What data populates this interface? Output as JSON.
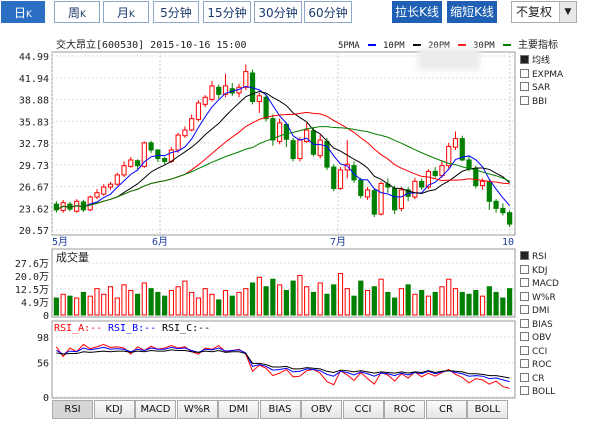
{
  "tabs": [
    {
      "label": "日",
      "k": "K"
    },
    {
      "label": "周",
      "k": "K"
    },
    {
      "label": "月",
      "k": "K"
    },
    {
      "label": "5分钟",
      "k": ""
    },
    {
      "label": "15分钟",
      "k": ""
    },
    {
      "label": "30分钟",
      "k": ""
    },
    {
      "label": "60分钟",
      "k": ""
    }
  ],
  "buttons": {
    "stretch": "拉长K线",
    "shrink": "缩短K线",
    "adjust": "不复权"
  },
  "main": {
    "title": "交大昂立[600530] 2015-10-16 15:00",
    "ma_legend": [
      {
        "label": "5PMA",
        "color": "#0000ff"
      },
      {
        "label": "10PM",
        "color": "#000000"
      },
      {
        "label": "20PM",
        "color": "#ff0000"
      },
      {
        "label": "30PM",
        "color": "#008000"
      }
    ],
    "main_indicator_label": "主要指标",
    "y_ticks": [
      "44.99",
      "41.94",
      "38.88",
      "35.83",
      "32.78",
      "29.73",
      "26.67",
      "23.62",
      "20.57"
    ],
    "x_ticks": [
      "5月",
      "6月",
      "7月",
      "10"
    ]
  },
  "right_indicators": [
    {
      "label": "均线",
      "checked": true
    },
    {
      "label": "EXPMA",
      "checked": false
    },
    {
      "label": "SAR",
      "checked": false
    },
    {
      "label": "BBI",
      "checked": false
    }
  ],
  "volume": {
    "title": "成交量",
    "y_ticks": [
      "27.6万",
      "20.0万",
      "12.5万",
      "4.9万",
      "0"
    ]
  },
  "volume_indicators": [
    {
      "label": "RSI",
      "checked": true
    },
    {
      "label": "KDJ",
      "checked": false
    },
    {
      "label": "MACD",
      "checked": false
    },
    {
      "label": "W%R",
      "checked": false
    },
    {
      "label": "DMI",
      "checked": false
    },
    {
      "label": "BIAS",
      "checked": false
    },
    {
      "label": "OBV",
      "checked": false
    },
    {
      "label": "CCI",
      "checked": false
    },
    {
      "label": "ROC",
      "checked": false
    },
    {
      "label": "CR",
      "checked": false
    },
    {
      "label": "BOLL",
      "checked": false
    }
  ],
  "rsi": {
    "legend": [
      {
        "label": "RSI_A:--",
        "color": "#ff0000"
      },
      {
        "label": "RSI_B:--",
        "color": "#0000ff"
      },
      {
        "label": "RSI_C:--",
        "color": "#000000"
      }
    ],
    "y_ticks": [
      "98",
      "56",
      "0"
    ]
  },
  "bottom_tabs": [
    "RSI",
    "KDJ",
    "MACD",
    "W%R",
    "DMI",
    "BIAS",
    "OBV",
    "CCI",
    "ROC",
    "CR",
    "BOLL"
  ],
  "colors": {
    "up": "#ff0000",
    "down": "#008000",
    "accent": "#1f5fb4"
  },
  "chart_data": {
    "type": "candlestick",
    "ylim": [
      20.57,
      44.99
    ],
    "candles": [
      [
        24.2,
        23.4,
        24.6,
        23.0
      ],
      [
        23.3,
        24.4,
        24.8,
        23.0
      ],
      [
        24.2,
        23.5,
        24.5,
        23.2
      ],
      [
        23.2,
        24.6,
        24.9,
        23.0
      ],
      [
        24.5,
        23.4,
        24.8,
        23.1
      ],
      [
        23.4,
        25.2,
        25.4,
        23.2
      ],
      [
        25.2,
        25.8,
        26.3,
        24.9
      ],
      [
        25.6,
        26.6,
        27.0,
        25.4
      ],
      [
        26.6,
        27.0,
        27.3,
        26.2
      ],
      [
        27.0,
        28.3,
        28.6,
        26.8
      ],
      [
        28.3,
        29.6,
        30.2,
        28.0
      ],
      [
        29.5,
        30.4,
        30.8,
        29.3
      ],
      [
        30.3,
        29.6,
        30.5,
        29.1
      ],
      [
        29.5,
        32.8,
        33.0,
        29.3
      ],
      [
        32.8,
        31.8,
        33.1,
        31.4
      ],
      [
        31.8,
        30.6,
        31.9,
        30.1
      ],
      [
        30.6,
        30.2,
        30.8,
        29.8
      ],
      [
        30.2,
        31.8,
        32.2,
        30.0
      ],
      [
        31.8,
        33.9,
        34.2,
        31.4
      ],
      [
        33.8,
        34.6,
        35.1,
        33.5
      ],
      [
        34.6,
        36.2,
        36.8,
        34.4
      ],
      [
        36.1,
        38.4,
        38.8,
        35.8
      ],
      [
        38.2,
        39.2,
        39.5,
        37.8
      ],
      [
        38.9,
        40.8,
        41.5,
        38.6
      ],
      [
        40.6,
        39.6,
        41.0,
        39.0
      ],
      [
        39.6,
        40.8,
        42.5,
        39.2
      ],
      [
        40.4,
        39.8,
        41.2,
        39.4
      ],
      [
        39.8,
        40.6,
        41.1,
        39.2
      ],
      [
        40.6,
        42.8,
        43.8,
        40.2
      ],
      [
        42.6,
        38.6,
        43.1,
        38.2
      ],
      [
        38.6,
        39.4,
        39.8,
        37.0
      ],
      [
        39.2,
        36.2,
        39.6,
        35.8
      ],
      [
        36.2,
        33.2,
        36.8,
        32.4
      ],
      [
        33.0,
        35.6,
        36.2,
        32.6
      ],
      [
        35.4,
        33.3,
        35.7,
        32.2
      ],
      [
        33.1,
        30.6,
        33.5,
        30.2
      ],
      [
        30.6,
        33.2,
        33.6,
        30.2
      ],
      [
        33.0,
        34.6,
        35.6,
        32.8
      ],
      [
        34.5,
        31.2,
        35.0,
        30.9
      ],
      [
        31.0,
        33.2,
        33.9,
        30.6
      ],
      [
        33.0,
        29.4,
        33.5,
        29.0
      ],
      [
        29.4,
        26.4,
        29.8,
        26.0
      ],
      [
        26.4,
        29.0,
        29.4,
        26.2
      ],
      [
        29.0,
        29.8,
        33.2,
        27.8
      ],
      [
        29.6,
        27.6,
        30.2,
        27.2
      ],
      [
        27.6,
        25.4,
        27.9,
        25.0
      ],
      [
        25.2,
        26.2,
        26.6,
        24.8
      ],
      [
        26.1,
        22.8,
        26.4,
        22.4
      ],
      [
        22.8,
        27.1,
        27.4,
        22.6
      ],
      [
        27.0,
        26.6,
        27.8,
        25.8
      ],
      [
        26.4,
        23.4,
        26.8,
        22.8
      ],
      [
        23.6,
        26.2,
        26.6,
        23.2
      ],
      [
        26.2,
        25.3,
        26.6,
        24.6
      ],
      [
        25.2,
        27.4,
        27.9,
        24.9
      ],
      [
        27.4,
        26.6,
        27.8,
        26.2
      ],
      [
        26.6,
        28.8,
        29.1,
        26.3
      ],
      [
        28.8,
        28.2,
        29.4,
        27.9
      ],
      [
        28.2,
        29.6,
        30.4,
        27.9
      ],
      [
        29.6,
        32.3,
        32.8,
        29.2
      ],
      [
        32.2,
        33.4,
        34.4,
        31.8
      ],
      [
        33.4,
        30.4,
        33.8,
        30.2
      ],
      [
        30.4,
        29.2,
        30.9,
        28.8
      ],
      [
        29.2,
        26.8,
        29.6,
        26.4
      ],
      [
        26.8,
        27.4,
        27.8,
        26.2
      ],
      [
        27.3,
        24.6,
        27.6,
        23.4
      ],
      [
        24.6,
        23.6,
        24.9,
        23.0
      ],
      [
        23.6,
        23.0,
        24.3,
        22.6
      ],
      [
        23.0,
        21.4,
        23.3,
        21.0
      ]
    ],
    "volume_ylim": [
      0,
      27.6
    ],
    "volume": [
      9,
      11,
      10,
      9,
      12,
      10,
      14,
      11,
      15,
      9,
      16,
      13,
      11,
      17,
      14,
      12,
      10,
      13,
      15,
      18,
      12,
      9,
      14,
      11,
      8,
      13,
      10,
      12,
      14,
      17,
      20,
      15,
      19,
      16,
      13,
      18,
      21,
      15,
      12,
      17,
      11,
      16,
      22,
      14,
      10,
      18,
      13,
      15,
      19,
      12,
      9,
      14,
      16,
      11,
      13,
      10,
      12,
      15,
      19,
      14,
      12,
      11,
      13,
      10,
      15,
      12,
      9,
      14
    ],
    "rsi_ylim": [
      0,
      100
    ],
    "rsi_a": [
      82,
      66,
      80,
      74,
      86,
      79,
      82,
      86,
      81,
      82,
      80,
      70,
      82,
      76,
      83,
      78,
      80,
      84,
      80,
      82,
      74,
      70,
      80,
      78,
      84,
      74,
      76,
      78,
      70,
      42,
      52,
      47,
      35,
      39,
      45,
      33,
      34,
      43,
      45,
      39,
      25,
      20,
      43,
      36,
      27,
      40,
      30,
      21,
      40,
      36,
      26,
      38,
      31,
      41,
      33,
      39,
      34,
      40,
      45,
      37,
      32,
      23,
      30,
      28,
      21,
      26,
      17,
      14
    ],
    "rsi_b": [
      76,
      70,
      75,
      74,
      80,
      77,
      79,
      81,
      78,
      79,
      78,
      74,
      78,
      76,
      80,
      78,
      78,
      81,
      79,
      80,
      76,
      73,
      78,
      77,
      80,
      75,
      76,
      77,
      72,
      50,
      53,
      50,
      44,
      45,
      47,
      41,
      42,
      46,
      45,
      43,
      37,
      34,
      42,
      40,
      36,
      41,
      38,
      34,
      39,
      38,
      35,
      39,
      36,
      40,
      38,
      42,
      38,
      41,
      43,
      40,
      38,
      34,
      35,
      34,
      30,
      31,
      28,
      25
    ],
    "rsi_c": [
      72,
      70,
      71,
      71,
      74,
      73,
      74,
      75,
      74,
      75,
      75,
      73,
      75,
      74,
      76,
      75,
      75,
      77,
      76,
      76,
      74,
      73,
      75,
      74,
      76,
      73,
      74,
      74,
      71,
      55,
      55,
      53,
      49,
      49,
      50,
      46,
      46,
      48,
      47,
      46,
      42,
      40,
      44,
      43,
      41,
      43,
      41,
      39,
      41,
      40,
      39,
      41,
      39,
      41,
      40,
      43,
      40,
      42,
      43,
      42,
      41,
      38,
      38,
      37,
      35,
      35,
      33,
      31
    ]
  }
}
